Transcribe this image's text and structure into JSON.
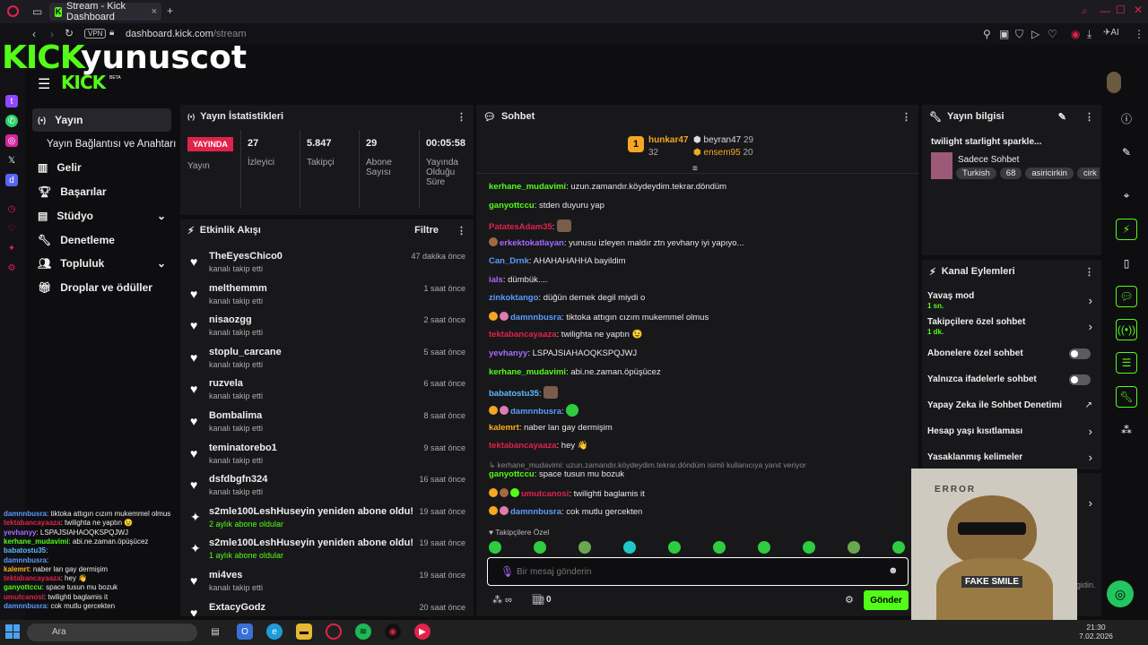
{
  "browser": {
    "tab_title": "Stream - Kick Dashboard",
    "new_tab": "+",
    "url_domain": "dashboard.kick.com",
    "url_path": "/stream",
    "vpn": "VPN",
    "ai": "AI"
  },
  "header": {
    "overlay_logo": "KICK",
    "overlay_name": "yunuscot",
    "logo": "KICK",
    "beta": "BETA"
  },
  "nav": {
    "items": [
      {
        "label": "Yayın",
        "icon": "broadcast-icon"
      },
      {
        "label": "Yayın Bağlantısı ve Anahtarı",
        "icon": ""
      },
      {
        "label": "Gelir",
        "icon": "chart-icon"
      },
      {
        "label": "Başarılar",
        "icon": "trophy-icon"
      },
      {
        "label": "Stüdyo",
        "icon": "studio-icon"
      },
      {
        "label": "Denetleme",
        "icon": "wrench-icon"
      },
      {
        "label": "Topluluk",
        "icon": "people-icon"
      },
      {
        "label": "Droplar ve ödüller",
        "icon": "gift-icon"
      }
    ]
  },
  "stats": {
    "title": "Yayın İstatistikleri",
    "live_badge": "YAYINDA",
    "status_label": "Yayın",
    "viewers": "27",
    "viewers_label": "İzleyici",
    "followers": "5.847",
    "followers_label": "Takipçi",
    "subs": "29",
    "subs_label": "Abone Sayısı",
    "uptime": "00:05:58",
    "uptime_label": "Yayında Olduğu Süre"
  },
  "activity": {
    "title": "Etkinlik Akışı",
    "filter": "Filtre",
    "items": [
      {
        "name": "TheEyesChico0",
        "sub": "kanalı takip etti",
        "time": "47 dakika önce",
        "icon": "heart"
      },
      {
        "name": "melthemmm",
        "sub": "kanalı takip etti",
        "time": "1 saat önce",
        "icon": "heart"
      },
      {
        "name": "nisaozgg",
        "sub": "kanalı takip etti",
        "time": "2 saat önce",
        "icon": "heart"
      },
      {
        "name": "stoplu_carcane",
        "sub": "kanalı takip etti",
        "time": "5 saat önce",
        "icon": "heart"
      },
      {
        "name": "ruzvela",
        "sub": "kanalı takip etti",
        "time": "6 saat önce",
        "icon": "heart"
      },
      {
        "name": "Bombalima",
        "sub": "kanalı takip etti",
        "time": "8 saat önce",
        "icon": "heart"
      },
      {
        "name": "teminatorebo1",
        "sub": "kanalı takip etti",
        "time": "9 saat önce",
        "icon": "heart"
      },
      {
        "name": "dsfdbgfn324",
        "sub": "kanalı takip etti",
        "time": "16 saat önce",
        "icon": "heart"
      },
      {
        "name": "s2mle100LeshHuseyin yeniden abone oldu!",
        "sub": "2 aylık abone oldular",
        "time": "19 saat önce",
        "icon": "star"
      },
      {
        "name": "s2mle100LeshHuseyin yeniden abone oldu!",
        "sub": "1 aylık abone oldular",
        "time": "19 saat önce",
        "icon": "star"
      },
      {
        "name": "mi4ves",
        "sub": "kanalı takip etti",
        "time": "19 saat önce",
        "icon": "heart"
      },
      {
        "name": "ExtacyGodz",
        "sub": "",
        "time": "20 saat önce",
        "icon": "heart"
      }
    ]
  },
  "chat": {
    "title": "Sohbet",
    "leaders": [
      {
        "rank": "1",
        "name": "hunkar47",
        "value": "32"
      },
      {
        "name": "beyran47",
        "value": "29"
      },
      {
        "name": "ensem95",
        "value": "20"
      }
    ],
    "messages": [
      {
        "user": "kerhane_mudavimi",
        "color": "#53fc18",
        "text": ": uzun.zamandır.köydeydim.tekrar.döndüm"
      },
      {
        "user": "ganyottccu",
        "color": "#53fc18",
        "text": ": stden duyuru yap"
      },
      {
        "user": "PatatesAdam35",
        "color": "#e0234a",
        "text": ": "
      },
      {
        "user": "erkektokatlayan",
        "color": "#a36bff",
        "text": ": yunusu izleyen maldır ztn yevhany iyi yapıyo..."
      },
      {
        "user": "Can_Drnk",
        "color": "#5b9bff",
        "text": ": AHAHAHAHHA bayildim"
      },
      {
        "user": "ials",
        "color": "#a36bff",
        "text": ": dümbük...."
      },
      {
        "user": "zinkoktango",
        "color": "#5b9bff",
        "text": ": düğün dernek degil miydi o"
      },
      {
        "user": "damnnbusra",
        "color": "#5b9bff",
        "text": ": tiktoka attıgın cızım mukemmel olmus"
      },
      {
        "user": "tektabancayaaza",
        "color": "#e0234a",
        "text": ": twilighta ne yaptın 😉"
      },
      {
        "user": "yevhanyy",
        "color": "#a36bff",
        "text": ": LSPAJSIAHAOQKSPQJWJ"
      },
      {
        "user": "kerhane_mudavimi",
        "color": "#53fc18",
        "text": ": abi.ne.zaman.öpüşücez"
      },
      {
        "user": "babatostu35",
        "color": "#5bbcff",
        "text": ": "
      },
      {
        "user": "damnnbusra",
        "color": "#5b9bff",
        "text": ": "
      },
      {
        "user": "kalemrt",
        "color": "#ffb020",
        "text": ": naber lan gay dermişim"
      },
      {
        "user": "tektabancayaaza",
        "color": "#e0234a",
        "text": ": hey 👋"
      },
      {
        "user": "ganyottccu",
        "color": "#53fc18",
        "text": ": space tusun mu bozuk"
      },
      {
        "user": "umutcanosi",
        "color": "#e0234a",
        "text": ": twilighti baglamis it"
      },
      {
        "user": "damnnbusra",
        "color": "#5b9bff",
        "text": ": cok mutlu gercekten"
      }
    ],
    "reply_note": "kerhane_mudavimi: uzun.zamandır.köydeydim.tekrar.döndüm isimli kullanıcıya yanıt veriyor",
    "follower_only": "Takipçilere Özel",
    "placeholder": "Bir mesaj gönderin",
    "points": "0",
    "send": "Gönder"
  },
  "info": {
    "title": "Yayın bilgisi",
    "stream_title": "twilight starlight sparkle...",
    "category": "Sadece Sohbet",
    "tags": [
      "Turkish",
      "68",
      "asiricirkin",
      "cirk"
    ]
  },
  "actions": {
    "title": "Kanal Eylemleri",
    "slow_mode": "Yavaş mod",
    "slow_value": "1 sn.",
    "follower_chat": "Takipçilere özel sohbet",
    "follower_value": "1 dk.",
    "sub_chat": "Abonelere özel sohbet",
    "emote_chat": "Yalnızca ifadelerle sohbet",
    "ai_mod": "Yapay Zeka ile Sohbet Denetimi",
    "age": "Hesap yaşı kısıtlaması",
    "banned_words": "Yasaklanmış kelimeler"
  },
  "overlay": {
    "chat": [
      {
        "user": "damnnbusra",
        "color": "#5b9bff",
        "text": ": tiktoka attıgın cızım mukemmel olmus"
      },
      {
        "user": "tektabancayaaza",
        "color": "#e0234a",
        "text": ": twilighta ne yaptın 😉"
      },
      {
        "user": "yevhanyy",
        "color": "#a36bff",
        "text": ": LSPAJSIAHAOQKSPQJWJ"
      },
      {
        "user": "kerhane_mudavimi",
        "color": "#53fc18",
        "text": ": abi.ne.zaman.öpüşücez"
      },
      {
        "user": "babatostu35",
        "color": "#5bbcff",
        "text": ": "
      },
      {
        "user": "damnnbusra",
        "color": "#5b9bff",
        "text": ": "
      },
      {
        "user": "kalemrt",
        "color": "#ffb020",
        "text": ": naber lan gay dermişim"
      },
      {
        "user": "tektabancayaaza",
        "color": "#e0234a",
        "text": ": hey 👋"
      },
      {
        "user": "ganyottccu",
        "color": "#53fc18",
        "text": ": space tusun mu bozuk"
      },
      {
        "user": "umutcanosi",
        "color": "#e0234a",
        "text": ": twilighti baglamis it"
      },
      {
        "user": "damnnbusra",
        "color": "#5b9bff",
        "text": ": cok mutlu gercekten"
      }
    ],
    "bear_error": "ERROR",
    "bear_fake": "FAKE SMILE",
    "gidin": "gidin."
  },
  "taskbar": {
    "search": "Ara",
    "time": "21:30",
    "date": "7.02.2026"
  }
}
